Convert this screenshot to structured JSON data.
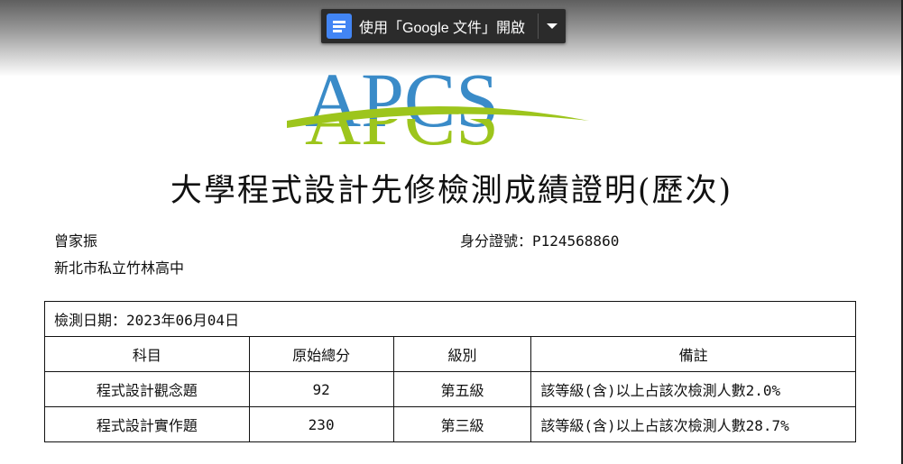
{
  "toolbar": {
    "open_with_label": "使用「Google 文件」開啟",
    "icon": "google-docs-icon",
    "dropdown_icon": "caret-down-icon"
  },
  "logo": {
    "text": "APCS",
    "colors": {
      "blue": "#3a8bc8",
      "green": "#9dc51c"
    }
  },
  "document": {
    "title": "大學程式設計先修檢測成績證明(歷次)",
    "student_name": "曾家振",
    "school": "新北市私立竹林高中",
    "id_label": "身分證號：P124568860",
    "test_date": "檢測日期：2023年06月04日",
    "table": {
      "headers": [
        "科目",
        "原始總分",
        "級別",
        "備註"
      ],
      "rows": [
        [
          "程式設計觀念題",
          "92",
          "第五級",
          "該等級(含)以上占該次檢測人數2.0%"
        ],
        [
          "程式設計實作題",
          "230",
          "第三級",
          "該等級(含)以上占該次檢測人數28.7%"
        ]
      ]
    }
  }
}
